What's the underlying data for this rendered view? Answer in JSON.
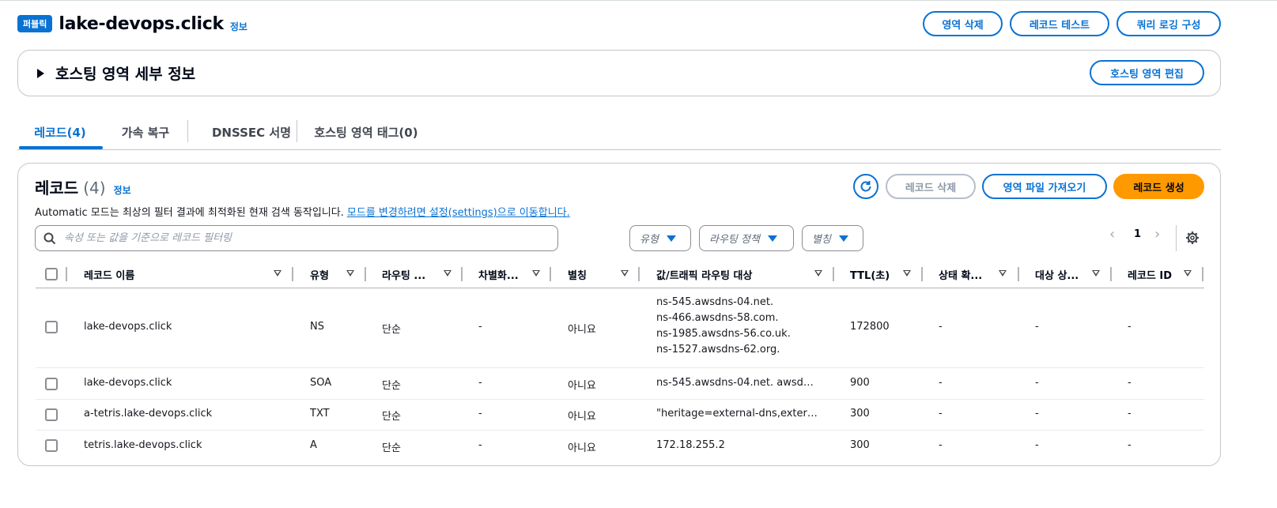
{
  "header": {
    "badge": "퍼블릭",
    "title": "lake-devops.click",
    "info": "정보",
    "buttons": {
      "delete_zone": "영역 삭제",
      "test_record": "레코드 테스트",
      "query_logging": "쿼리 로깅 구성"
    }
  },
  "details": {
    "title": "호스팅 영역 세부 정보",
    "edit_button": "호스팅 영역 편집"
  },
  "tabs": [
    {
      "label": "레코드(4)",
      "active": true
    },
    {
      "label": "가속 복구",
      "active": false
    },
    {
      "label": "DNSSEC 서명",
      "active": false
    },
    {
      "label": "호스팅 영역 태그(0)",
      "active": false
    }
  ],
  "records": {
    "title": "레코드",
    "count": "(4)",
    "info": "정보",
    "description": "Automatic 모드는 최상의 필터 결과에 최적화된 현재 검색 동작입니다.",
    "description_link": "모드를 변경하려면 설정(settings)으로 이동합니다.",
    "buttons": {
      "delete_record": "레코드 삭제",
      "import_zone_file": "영역 파일 가져오기",
      "create_record": "레코드 생성"
    },
    "search_placeholder": "속성 또는 값을 기준으로 레코드 필터링",
    "filters": {
      "type": "유형",
      "routing_policy": "라우팅 정책",
      "alias": "별칭"
    },
    "pagination": {
      "current_page": "1",
      "prev": "‹",
      "next": "›"
    },
    "columns": {
      "name": "레코드 이름",
      "type": "유형",
      "routing": "라우팅 ...",
      "differentiator": "차별화...",
      "alias": "별칭",
      "value": "값/트래픽 라우팅 대상",
      "ttl": "TTL(초)",
      "health_check": "상태 확...",
      "evaluate_target": "대상 상...",
      "record_id": "레코드 ID"
    },
    "rows": [
      {
        "name": "lake-devops.click",
        "type": "NS",
        "routing": "단순",
        "differentiator": "-",
        "alias": "아니요",
        "values": [
          "ns-545.awsdns-04.net.",
          "ns-466.awsdns-58.com.",
          "ns-1985.awsdns-56.co.uk.",
          "ns-1527.awsdns-62.org."
        ],
        "ttl": "172800",
        "health_check": "-",
        "evaluate_target": "-",
        "record_id": "-"
      },
      {
        "name": "lake-devops.click",
        "type": "SOA",
        "routing": "단순",
        "differentiator": "-",
        "alias": "아니요",
        "values": [
          "ns-545.awsdns-04.net. awsd…"
        ],
        "ttl": "900",
        "health_check": "-",
        "evaluate_target": "-",
        "record_id": "-"
      },
      {
        "name": "a-tetris.lake-devops.click",
        "type": "TXT",
        "routing": "단순",
        "differentiator": "-",
        "alias": "아니요",
        "values": [
          "\"heritage=external-dns,exter…"
        ],
        "ttl": "300",
        "health_check": "-",
        "evaluate_target": "-",
        "record_id": "-"
      },
      {
        "name": "tetris.lake-devops.click",
        "type": "A",
        "routing": "단순",
        "differentiator": "-",
        "alias": "아니요",
        "values": [
          "172.18.255.2"
        ],
        "ttl": "300",
        "health_check": "-",
        "evaluate_target": "-",
        "record_id": "-"
      }
    ]
  },
  "colors": {
    "accent": "#0972d3",
    "primary_button": "#ff9900",
    "border": "#c6c6cd"
  }
}
